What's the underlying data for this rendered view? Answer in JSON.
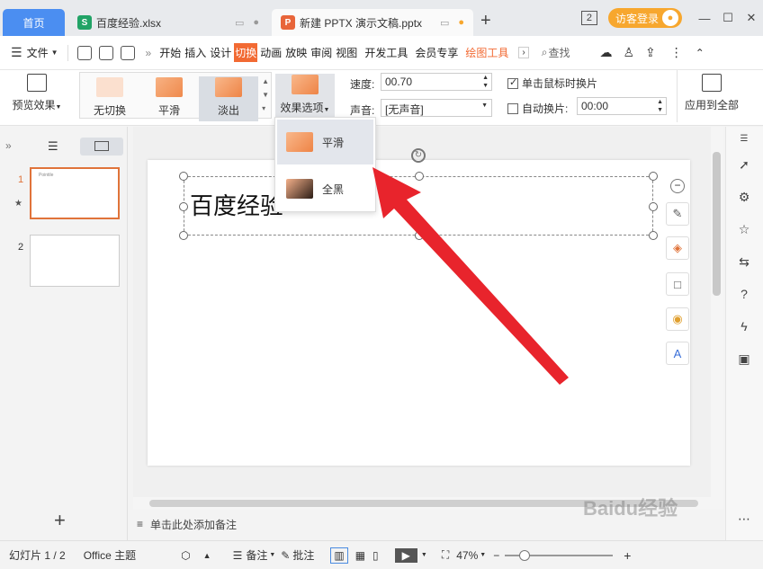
{
  "titlebar": {
    "home_tab": "首页",
    "tabs": [
      {
        "label": "百度经验.xlsx",
        "icon": "S"
      },
      {
        "label": "新建 PPTX 演示文稿.pptx",
        "icon": "P"
      }
    ],
    "login_label": "访客登录",
    "page_count_badge": "2"
  },
  "menubar": {
    "file_label": "文件",
    "items": [
      "开始",
      "插入",
      "设计",
      "切换",
      "动画",
      "放映",
      "审阅",
      "视图",
      "开发工具",
      "会员专享",
      "绘图工具"
    ],
    "active_item": "切换",
    "search_label": "查找"
  },
  "ribbon": {
    "preview_label": "预览效果",
    "transitions": [
      "无切换",
      "平滑",
      "淡出"
    ],
    "effect_options_label": "效果选项",
    "speed_label": "速度:",
    "speed_value": "00.70",
    "sound_label": "声音:",
    "sound_value": "[无声音]",
    "on_click_label": "单击鼠标时换片",
    "auto_label": "自动换片:",
    "auto_value": "00:00",
    "apply_all_label": "应用到全部"
  },
  "dropdown": {
    "items": [
      "平滑",
      "全黑"
    ]
  },
  "slides": {
    "thumb1_title": "Pointile",
    "numbers": [
      "1",
      "2"
    ],
    "star": "★"
  },
  "slide": {
    "title": "百度经验"
  },
  "notes": {
    "placeholder": "单击此处添加备注"
  },
  "status": {
    "slide_info": "幻灯片 1 / 2",
    "theme": "Office 主题",
    "notes_label": "备注",
    "comments_label": "批注",
    "zoom": "47%"
  },
  "watermark": "Baidu经验",
  "colors": {
    "home_tab": "#4b8ef1",
    "accent": "#f26a33",
    "login": "#f7a72e",
    "arrow": "#e8242c"
  }
}
